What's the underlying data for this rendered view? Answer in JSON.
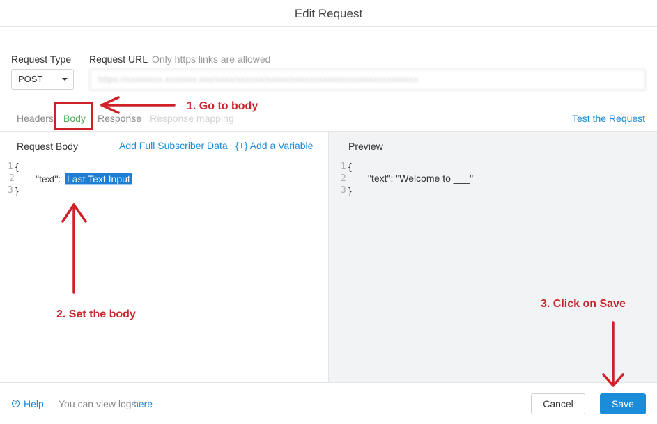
{
  "dialog": {
    "title": "Edit Request"
  },
  "request_type": {
    "label": "Request Type",
    "value": "POST"
  },
  "request_url": {
    "label": "Request URL",
    "hint": "Only https links are allowed",
    "value": "https://xxxxxxxx.xxxxxxx.xxx/xxxx/xxxxxx/xxxxx/xxxxxxxxxxxxxxxxxxxxxxxxxxxx"
  },
  "tabs": [
    {
      "label": "Headers"
    },
    {
      "label": "Body"
    },
    {
      "label": "Response"
    },
    {
      "label": "Response mapping"
    }
  ],
  "test_request": "Test the Request",
  "request_body": {
    "label": "Request Body",
    "add_subscriber": "Add Full Subscriber Data",
    "add_variable": "{+} Add a Variable",
    "line_numbers": [
      "1",
      "2",
      "3"
    ],
    "open_brace": "{",
    "key": "\"text\":",
    "token": "Last Text Input",
    "close_brace": "}"
  },
  "preview": {
    "label": "Preview",
    "line_numbers": [
      "1",
      "2",
      "3"
    ],
    "open_brace": "{",
    "line": "\"text\": \"Welcome to ___\"",
    "close_brace": "}"
  },
  "footer": {
    "help": "Help",
    "logs_text": "You can view logs",
    "logs_link": "here",
    "cancel": "Cancel",
    "save": "Save",
    "help_icon": "question-circle-icon"
  },
  "annotations": {
    "step1": "1. Go to body",
    "step2": "2. Set the body",
    "step3": "3. Click on Save",
    "color": "#c9252c"
  },
  "colors": {
    "accent": "#1a8cd8",
    "active_tab": "#4caf50",
    "preview_bg": "#f1f3f5"
  }
}
